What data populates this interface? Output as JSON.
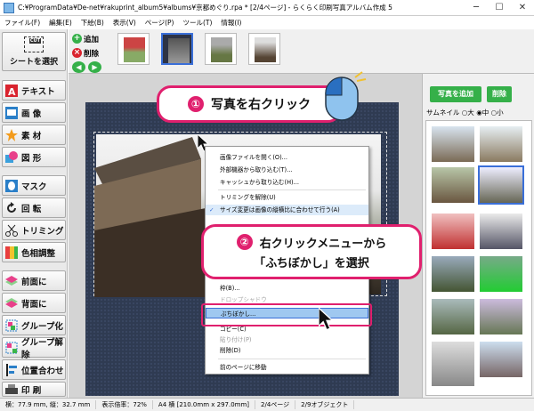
{
  "titlebar": {
    "title": "C:¥ProgramData¥De-net¥rakuprint_album5¥albums¥京都めぐり.rpa * [2/4ページ] - らくらく印刷写真アルバム作成 5",
    "minimize": "─",
    "maximize": "☐",
    "close": "✕"
  },
  "menubar": {
    "items": [
      "ファイル(F)",
      "編集(E)",
      "下絵(B)",
      "表示(V)",
      "ページ(P)",
      "ツール(T)",
      "情報(I)"
    ]
  },
  "left_panel": {
    "select": "シートを選択",
    "cut_badge": "CUT",
    "buttons": [
      "テキスト",
      "画 像",
      "素 材",
      "図 形",
      "マスク",
      "回 転",
      "トリミング",
      "色相調整",
      "前面に",
      "背面に",
      "グループ化",
      "グループ解除",
      "位置合わせ",
      "印 刷"
    ]
  },
  "toolbar": {
    "add": "追加",
    "delete": "削除",
    "prev": "◀",
    "next": "▶"
  },
  "right_panel": {
    "add_photo": "写真を追加",
    "delete": "削除",
    "thumb_size_label": "サムネイル",
    "sizes": [
      "大",
      "中",
      "小"
    ],
    "selected_size": "中"
  },
  "context_menu": {
    "items": [
      "画像ファイルを開く(O)...",
      "外部機器から取り込む(T)...",
      "キャッシュから取り込む(H)...",
      "トリミングを解除(U)",
      "サイズ変更は画像の縦横比に合わせて行う(A)",
      "枠(B)...",
      "ぶちぼかし...",
      "コピー(C)",
      "貼り付け(P)",
      "削除(D)",
      "前のページに移動"
    ],
    "hidden_items": [
      "ドロップシャドウ",
      "ふちぼかし..."
    ],
    "checked_index": 4,
    "highlight_index": 6
  },
  "callouts": {
    "step1_num": "①",
    "step1_text": "写真を右クリック",
    "step2_num": "②",
    "step2_line1": "右クリックメニューから",
    "step2_line2": "「ふちぼかし」を選択"
  },
  "statusbar": {
    "position": "横：77.9 mm, 縦：32.7 mm",
    "zoom": "表示倍率：72%",
    "paper": "A4 横 [210.0mm x 297.0mm]",
    "page": "2/4ページ",
    "objects": "2/9オブジェクト"
  },
  "colors": {
    "accent": "#e0206e",
    "green": "#35b049",
    "select_blue": "#3a6fd8"
  }
}
